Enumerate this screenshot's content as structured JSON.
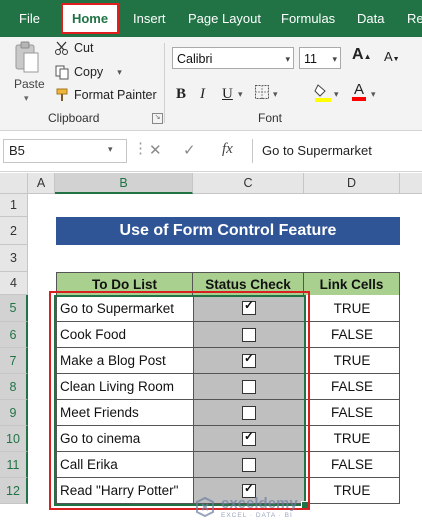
{
  "ribbon_tabs": [
    "File",
    "Home",
    "Insert",
    "Page Layout",
    "Formulas",
    "Data",
    "Re"
  ],
  "active_tab": "Home",
  "clipboard": {
    "paste": "Paste",
    "cut": "Cut",
    "copy": "Copy",
    "format_painter": "Format Painter",
    "group_label": "Clipboard"
  },
  "font": {
    "name": "Calibri",
    "size": "11",
    "group_label": "Font",
    "bold": "B",
    "italic": "I",
    "underline": "U",
    "grow": "A",
    "shrink": "A"
  },
  "formula_bar": {
    "name_box": "B5",
    "fx": "fx",
    "content": "Go to Supermarket"
  },
  "columns": [
    "A",
    "B",
    "C",
    "D"
  ],
  "rows": [
    "1",
    "2",
    "3",
    "4",
    "5",
    "6",
    "7",
    "8",
    "9",
    "10",
    "11",
    "12"
  ],
  "sheet": {
    "title": "Use of Form Control Feature",
    "headers": [
      "To Do List",
      "Status Check",
      "Link Cells"
    ],
    "tasks": [
      {
        "task": "Go to Supermarket",
        "checked": true,
        "link": "TRUE"
      },
      {
        "task": "Cook Food",
        "checked": false,
        "link": "FALSE"
      },
      {
        "task": "Make a Blog Post",
        "checked": true,
        "link": "TRUE"
      },
      {
        "task": "Clean Living Room",
        "checked": false,
        "link": "FALSE"
      },
      {
        "task": "Meet Friends",
        "checked": false,
        "link": "FALSE"
      },
      {
        "task": "Go to cinema",
        "checked": true,
        "link": "TRUE"
      },
      {
        "task": "Call Erika",
        "checked": false,
        "link": "FALSE"
      },
      {
        "task": "Read \"Harry Potter\"",
        "checked": true,
        "link": "TRUE"
      }
    ]
  },
  "watermark": {
    "name": "exceldemy",
    "tagline": "EXCEL · DATA · BI"
  },
  "colors": {
    "excel_green": "#217346",
    "title_blue": "#2f5597",
    "header_green": "#a9d08e",
    "selection_grey": "#bfbfbf",
    "highlight_red": "#d92020"
  }
}
